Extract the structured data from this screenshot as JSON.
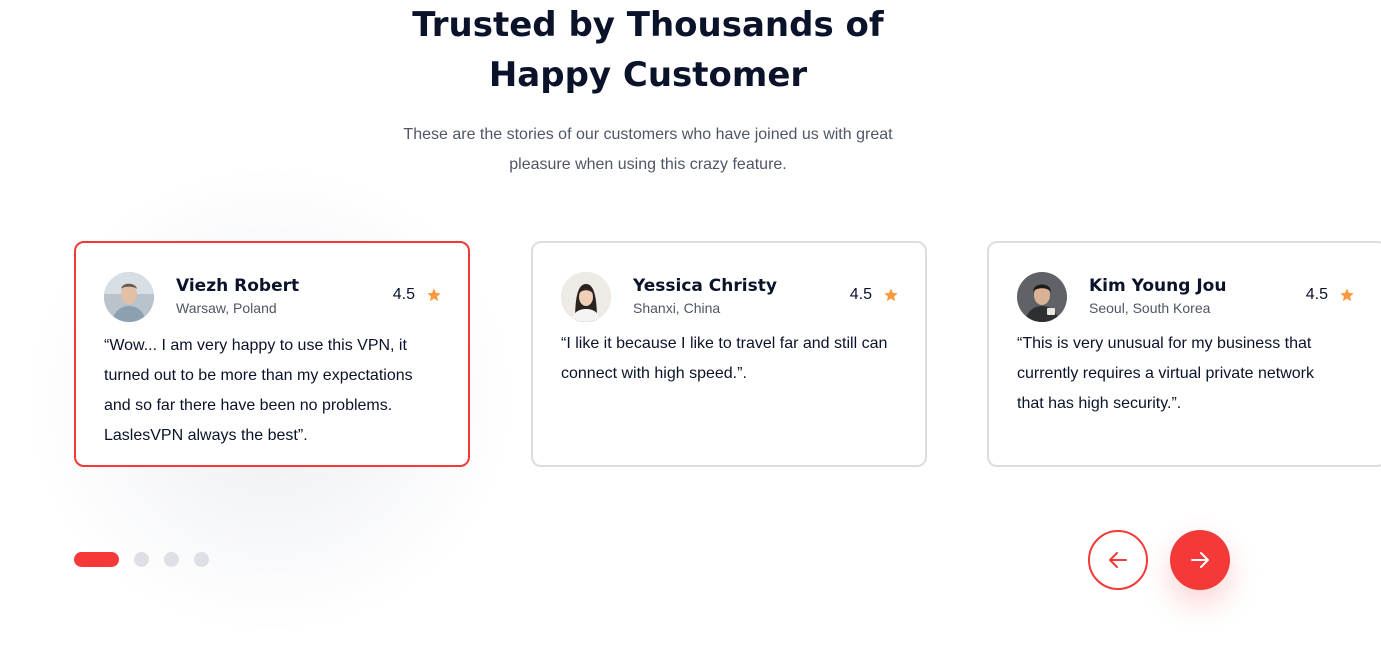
{
  "section": {
    "title_line1": "Trusted by Thousands of",
    "title_line2": "Happy Customer",
    "subtitle_line1": "These are the stories of our customers who have joined us with great",
    "subtitle_line2": "pleasure when using this crazy feature."
  },
  "testimonials": [
    {
      "name": "Viezh Robert",
      "location": "Warsaw, Poland",
      "rating": "4.5",
      "quote_lines": [
        "“Wow... I am very happy to use this VPN, it",
        "turned out to be more than my expectations",
        "and so far there have been no problems.",
        "LaslesVPN always the best”."
      ]
    },
    {
      "name": "Yessica Christy",
      "location": "Shanxi, China",
      "rating": "4.5",
      "quote_lines": [
        "“I like it because I like to travel far and still can",
        "connect with high speed.”."
      ]
    },
    {
      "name": "Kim Young Jou",
      "location": "Seoul, South Korea",
      "rating": "4.5",
      "quote_lines": [
        "“This is very unusual for my business that",
        "currently requires a virtual private network",
        "that has high security.”."
      ]
    }
  ],
  "carousel": {
    "active_index": 1,
    "total_dots": 4
  },
  "icons": {
    "star": "star-icon",
    "prev": "arrow-left-icon",
    "next": "arrow-right-icon"
  },
  "colors": {
    "accent": "#f53838",
    "star": "#fe9940",
    "heading": "#0b132a",
    "muted": "#4f5665",
    "dot_inactive": "#dde0e4",
    "card_border": "#dddddd"
  }
}
